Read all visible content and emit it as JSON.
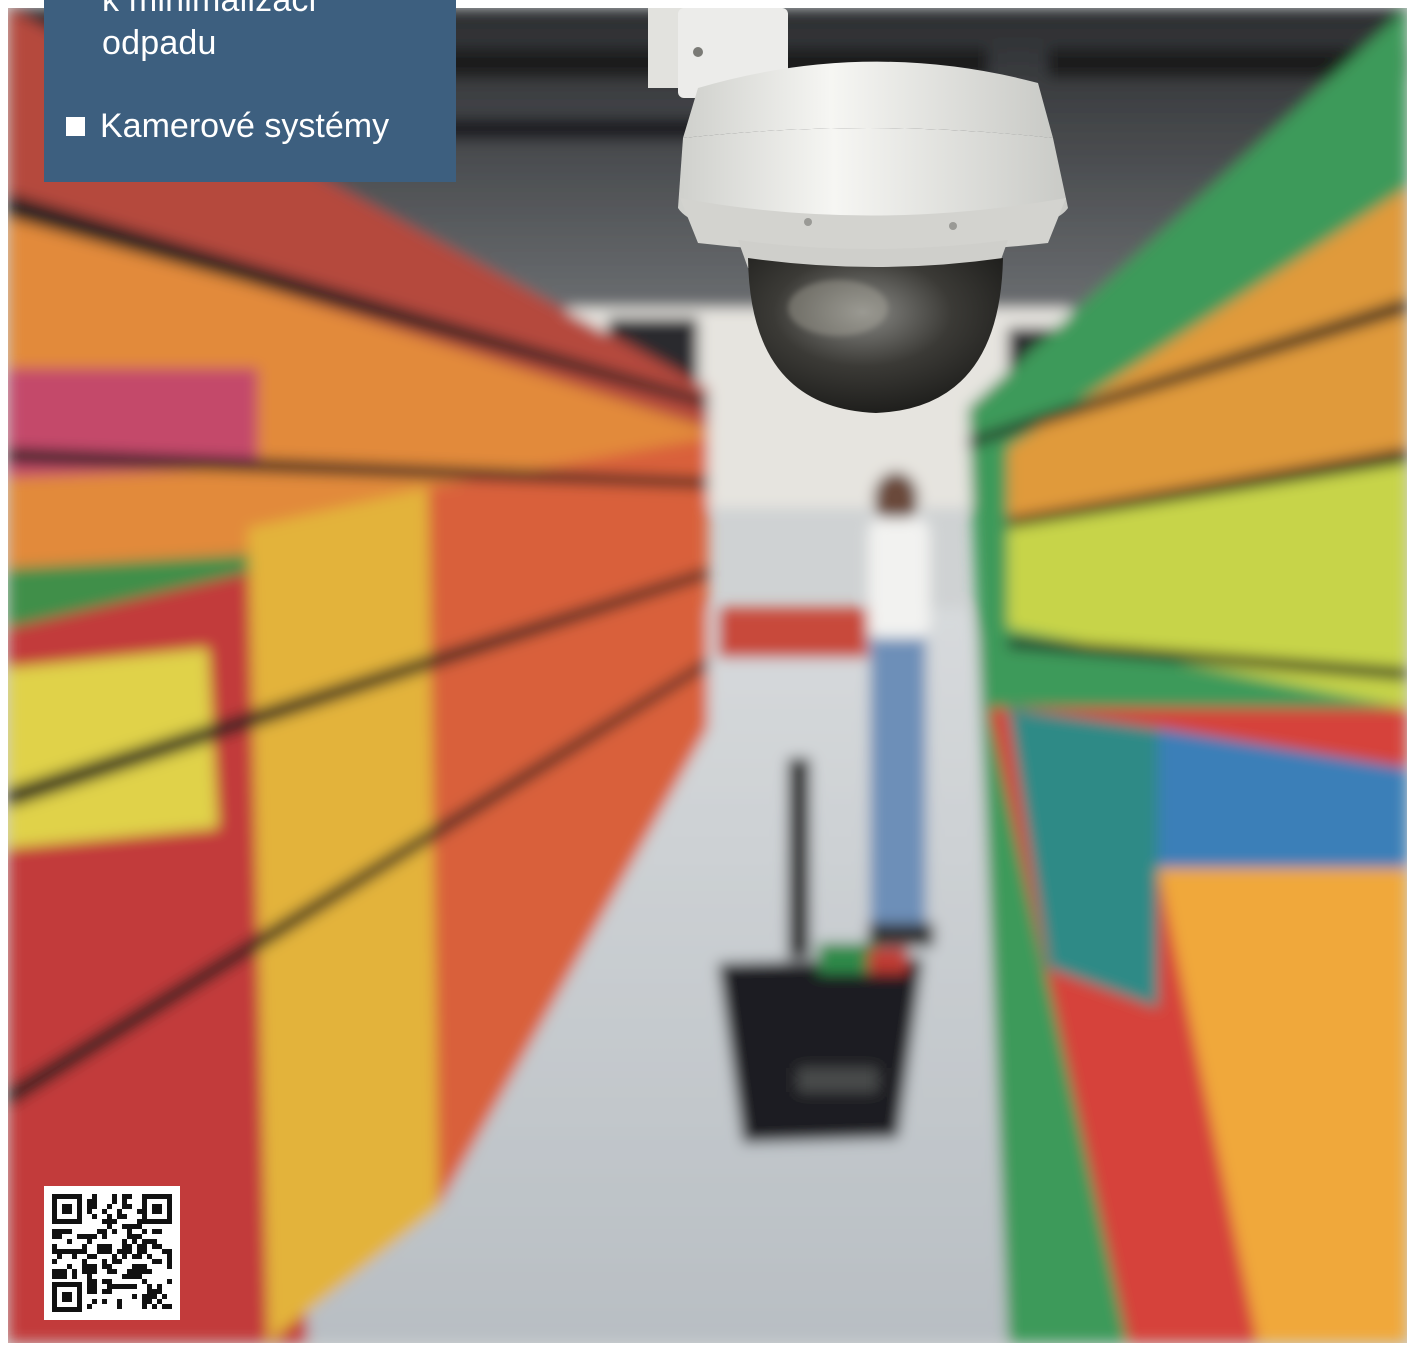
{
  "panel": {
    "heading_line1": "k minimalizaci",
    "heading_line2": "odpadu",
    "list_item": "Kamerové systémy"
  },
  "colors": {
    "panel_bg": "#3d5f7f",
    "panel_text": "#ffffff"
  },
  "icons": {
    "bullet": "square-bullet-icon",
    "qr": "qr-code-icon"
  }
}
